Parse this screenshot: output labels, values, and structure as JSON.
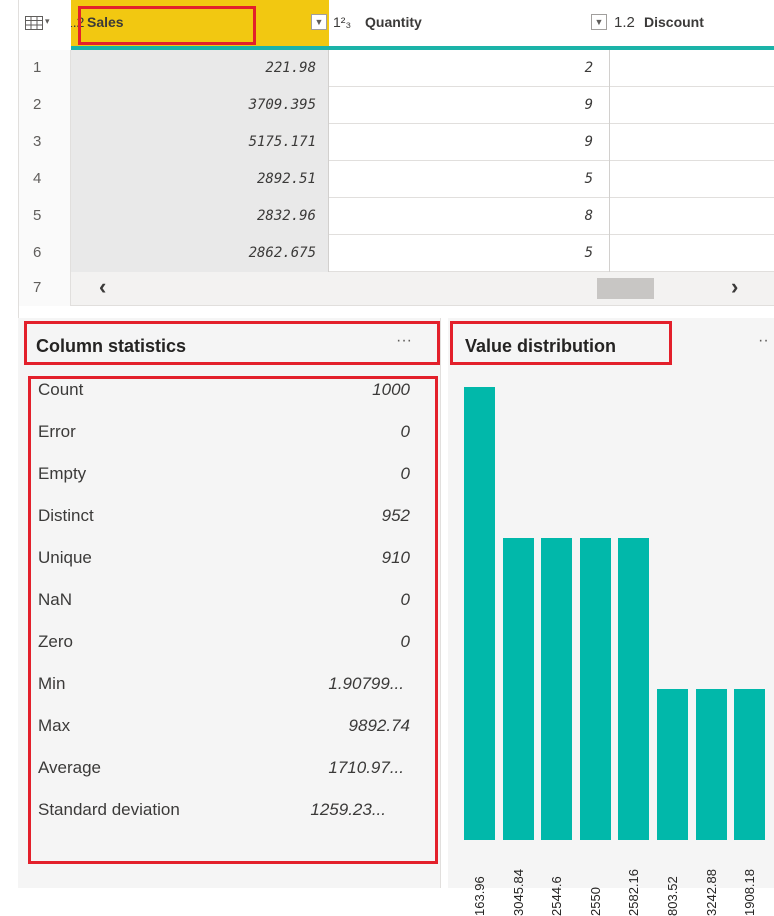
{
  "columns": {
    "sales": {
      "type_icon": "1.2",
      "name": "Sales"
    },
    "quantity": {
      "type_icon": "1²₃",
      "name": "Quantity"
    },
    "discount": {
      "type_icon": "1.2",
      "name": "Discount"
    }
  },
  "rows": [
    {
      "num": "1",
      "sales": "221.98",
      "quantity": "2"
    },
    {
      "num": "2",
      "sales": "3709.395",
      "quantity": "9"
    },
    {
      "num": "3",
      "sales": "5175.171",
      "quantity": "9"
    },
    {
      "num": "4",
      "sales": "2892.51",
      "quantity": "5"
    },
    {
      "num": "5",
      "sales": "2832.96",
      "quantity": "8"
    },
    {
      "num": "6",
      "sales": "2862.675",
      "quantity": "5"
    },
    {
      "num": "7"
    }
  ],
  "statistics": {
    "title": "Column statistics",
    "more": "···",
    "items": [
      {
        "label": "Count",
        "value": "1000"
      },
      {
        "label": "Error",
        "value": "0"
      },
      {
        "label": "Empty",
        "value": "0"
      },
      {
        "label": "Distinct",
        "value": "952"
      },
      {
        "label": "Unique",
        "value": "910"
      },
      {
        "label": "NaN",
        "value": "0"
      },
      {
        "label": "Zero",
        "value": "0"
      },
      {
        "label": "Min",
        "value": "1.90799..."
      },
      {
        "label": "Max",
        "value": "9892.74"
      },
      {
        "label": "Average",
        "value": "1710.97..."
      },
      {
        "label": "Standard deviation",
        "value": "1259.23..."
      }
    ]
  },
  "distribution": {
    "title": "Value distribution",
    "more": "··"
  },
  "chart_data": {
    "type": "bar",
    "categories": [
      "163.96",
      "3045.84",
      "2544.6",
      "2550",
      "2582.16",
      "803.52",
      "3242.88",
      "1908.18"
    ],
    "values": [
      3,
      2,
      2,
      2,
      2,
      1,
      1,
      1
    ],
    "color": "#01b8aa"
  },
  "colors": {
    "accent": "#1bb3a8",
    "highlight": "#f2c811",
    "annotation": "#e3202b"
  }
}
